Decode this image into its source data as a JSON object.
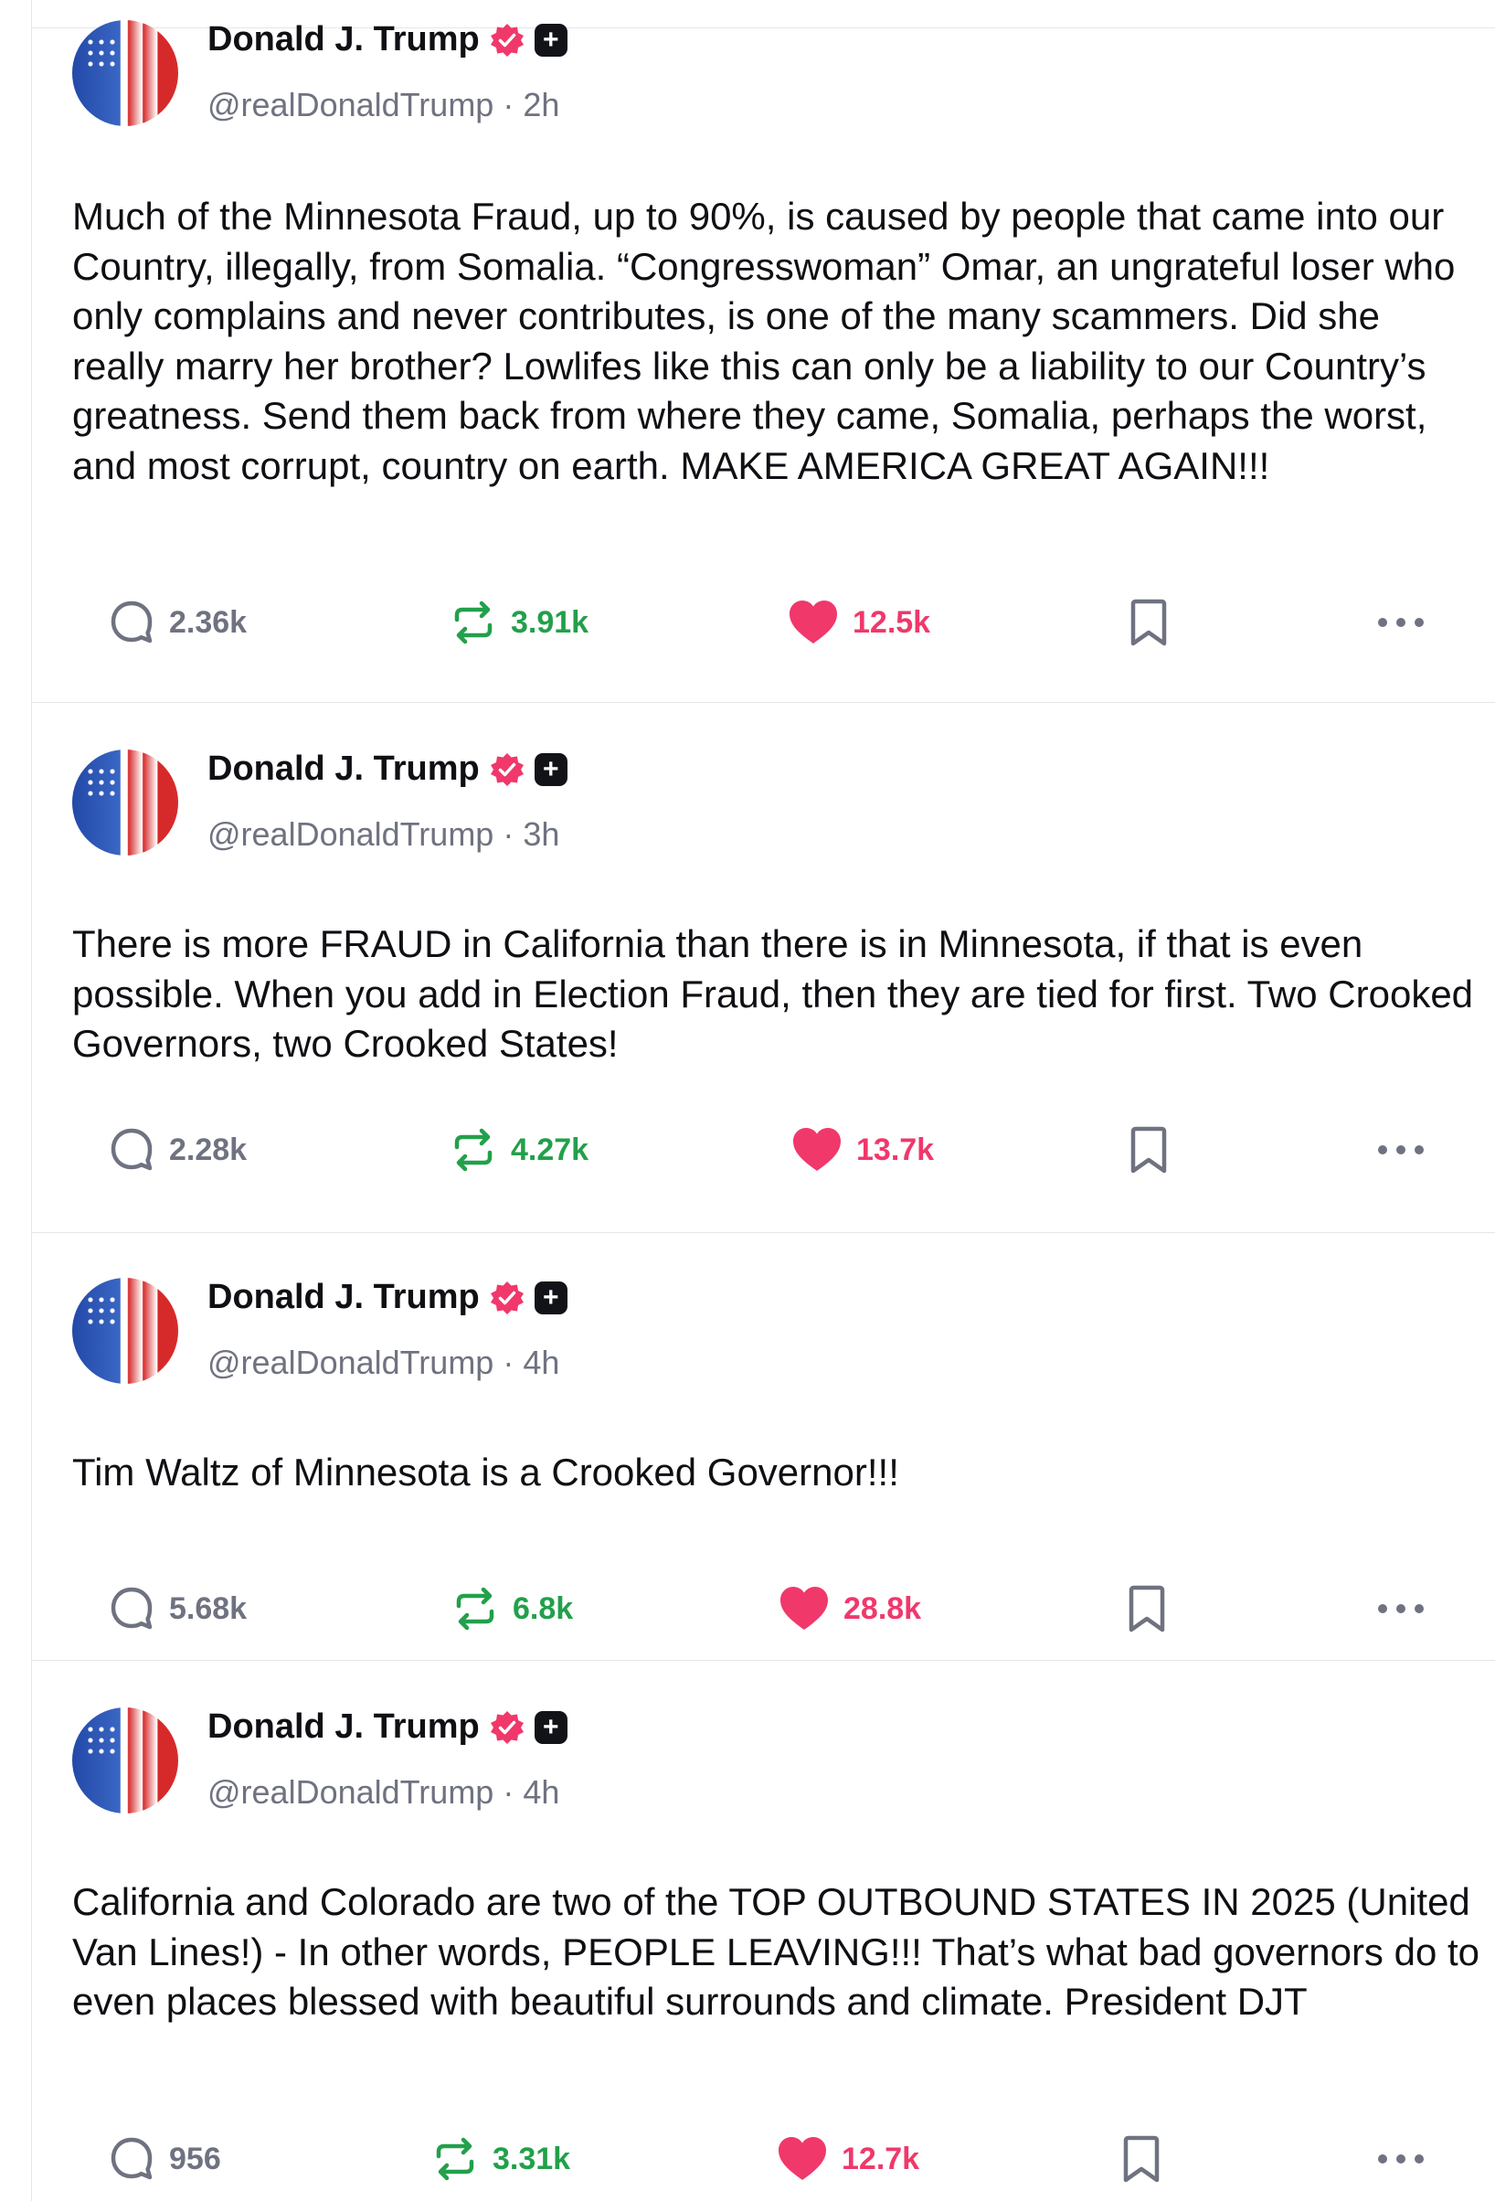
{
  "posts": [
    {
      "author": "Donald J. Trump",
      "handle": "@realDonaldTrump · 2h",
      "text": "Much of the Minnesota Fraud, up to 90%, is caused by people that came into our Country, illegally, from Somalia. “Congresswoman” Omar, an ungrateful loser who only complains and never contributes, is one of the many scammers. Did she really marry her brother? Lowlifes like this can only be a liability to our Country’s greatness. Send them back from where they came, Somalia, perhaps the worst, and most corrupt, country on earth. MAKE AMERICA GREAT AGAIN!!!",
      "replies": "2.36k",
      "reposts": "3.91k",
      "likes": "12.5k"
    },
    {
      "author": "Donald J. Trump",
      "handle": "@realDonaldTrump · 3h",
      "text": "There is more FRAUD in California than there is in Minnesota, if that is even possible. When you add in Election Fraud, then they are tied for first. Two Crooked Governors, two Crooked States!",
      "replies": "2.28k",
      "reposts": "4.27k",
      "likes": "13.7k"
    },
    {
      "author": "Donald J. Trump",
      "handle": "@realDonaldTrump · 4h",
      "text": "Tim Waltz of Minnesota is a Crooked Governor!!!",
      "replies": "5.68k",
      "reposts": "6.8k",
      "likes": "28.8k"
    },
    {
      "author": "Donald J. Trump",
      "handle": "@realDonaldTrump · 4h",
      "text": "California and Colorado are two of the TOP OUTBOUND STATES IN 2025 (United Van Lines!) - In other words, PEOPLE LEAVING!!! That’s what bad governors do to even places blessed with beautiful surrounds and climate. President DJT",
      "replies": "956",
      "reposts": "3.31k",
      "likes": "12.7k"
    }
  ],
  "colors": {
    "text": "#0f0f14",
    "muted": "#6f7280",
    "repost": "#22a04a",
    "like": "#f0386b",
    "verified": "#f0386b",
    "divider": "#e6e6ea"
  }
}
